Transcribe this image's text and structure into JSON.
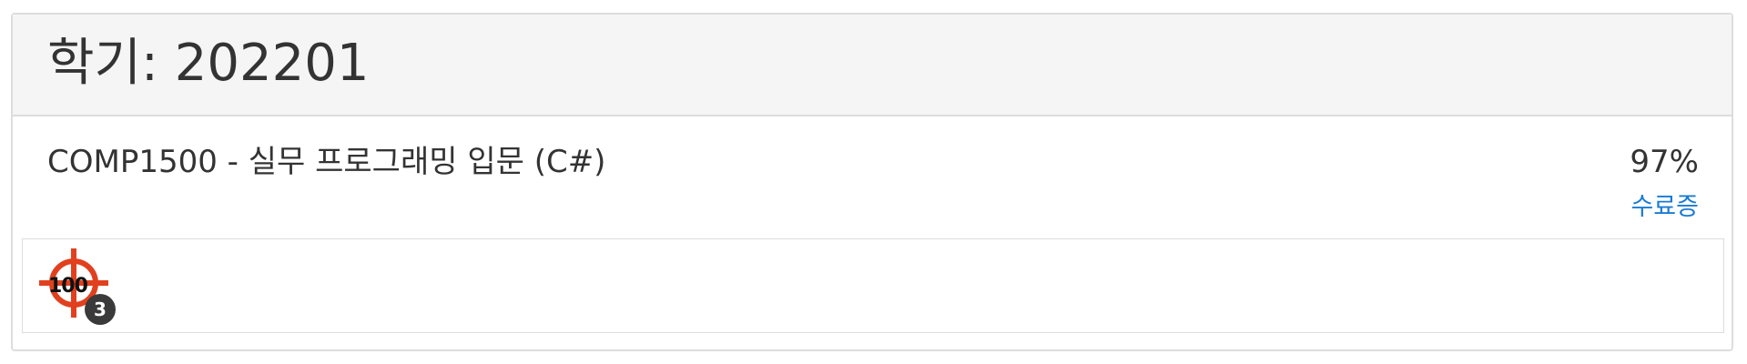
{
  "semester": {
    "title": "학기: 202201"
  },
  "course": {
    "name": "COMP1500 - 실무 프로그래밍 입문 (C#)",
    "score": "97%",
    "certificate_label": "수료증"
  },
  "badges": [
    {
      "icon": "target-100-icon",
      "text": "100",
      "count": "3",
      "color": "#e1401f"
    }
  ],
  "colors": {
    "heading_bg": "#f5f5f5",
    "border": "#dddddd",
    "link": "#1a7bd3",
    "badge_count_bg": "#3a3a3a"
  }
}
